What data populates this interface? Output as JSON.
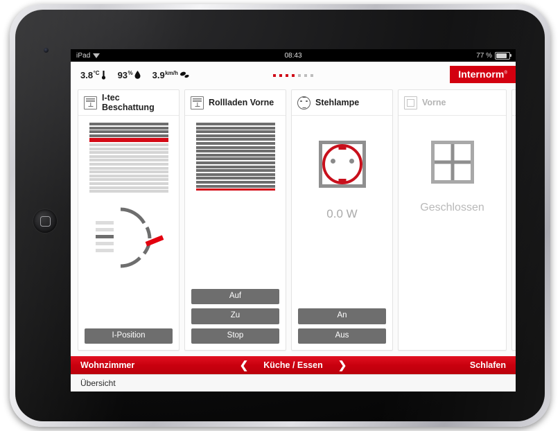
{
  "status_bar": {
    "carrier": "iPad",
    "wifi_icon": "wifi-icon",
    "time": "08:43",
    "battery_text": "77 %",
    "battery_icon": "battery-icon"
  },
  "app": {
    "brand": "Internorm",
    "brand_tm": "®",
    "brand_color": "#d3000f",
    "weather": [
      {
        "value": "3.8",
        "unit": "°C",
        "icon": "thermometer-icon"
      },
      {
        "value": "93",
        "unit": "%",
        "icon": "humidity-drop-icon"
      },
      {
        "value": "3.9",
        "unit": "km/h",
        "icon": "wind-icon"
      }
    ],
    "page_dots": {
      "total": 7,
      "active": 4
    },
    "cards": [
      {
        "id": "i-tec-beschattung",
        "icon": "blind-icon",
        "title_line1": "I-tec",
        "title_line2": "Beschattung",
        "widget": "blind-dial",
        "blind": {
          "dark_slats": 4,
          "red_slat": true,
          "light_slats": 13
        },
        "dial": {
          "marks": 5,
          "active_mark": 3,
          "indicator_color": "#e3000f"
        },
        "buttons": [
          {
            "label": "I-Position"
          }
        ],
        "disabled": false
      },
      {
        "id": "rollladen-vorne",
        "icon": "blind-icon",
        "title_line1": "Rollladen Vorne",
        "title_line2": "",
        "widget": "blind",
        "blind": {
          "dark_slats": 17,
          "red_line_bottom": true,
          "light_slats": 0
        },
        "buttons": [
          {
            "label": "Auf"
          },
          {
            "label": "Zu"
          },
          {
            "label": "Stop"
          }
        ],
        "disabled": false
      },
      {
        "id": "stehlampe",
        "icon": "socket-icon",
        "title_line1": "Stehlampe",
        "title_line2": "",
        "widget": "socket",
        "reading": "0.0 W",
        "buttons": [
          {
            "label": "An"
          },
          {
            "label": "Aus"
          }
        ],
        "disabled": false
      },
      {
        "id": "vorne",
        "icon": "window-icon",
        "title_line1": "Vorne",
        "title_line2": "",
        "widget": "window",
        "status": "Geschlossen",
        "buttons": [],
        "disabled": true
      },
      {
        "id": "partial-card",
        "icon": "blind-icon",
        "title_line1": "",
        "title_line2": "",
        "widget": "none",
        "buttons": [],
        "disabled": false
      }
    ],
    "nav": {
      "left_label": "Wohnzimmer",
      "prev_icon": "chevron-left-icon",
      "center_label": "Küche / Essen",
      "next_icon": "chevron-right-icon",
      "right_label": "Schlafen",
      "bar_color": "#c8000e"
    },
    "sub_nav": {
      "label": "Übersicht"
    }
  }
}
